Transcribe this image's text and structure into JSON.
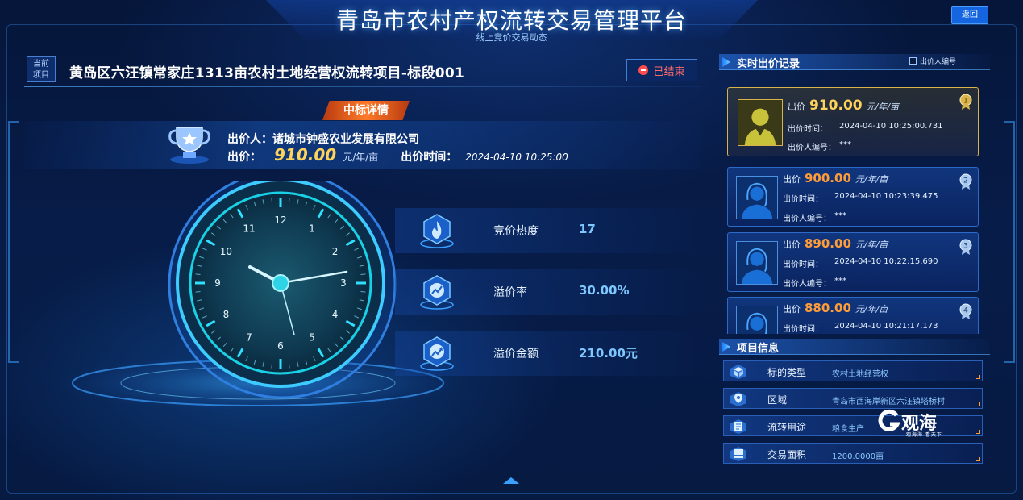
{
  "header": {
    "title": "青岛市农村产权流转交易管理平台",
    "subtitle": "线上竞价交易动态",
    "back_label": "返回"
  },
  "project": {
    "tag_line1": "当前",
    "tag_line2": "项目",
    "title": "黄岛区六汪镇常家庄1313亩农村土地经营权流转项目-标段001",
    "status": "已结束"
  },
  "winner": {
    "section_title": "中标详情",
    "bidder_label": "出价人：",
    "bidder_name": "诸城市钟盛农业发展有限公司",
    "price_label": "出价：",
    "price": "910.00",
    "unit": "元/年/亩",
    "time_label": "出价时间：",
    "time": "2024-04-10 10:25:00"
  },
  "clock": {
    "numbers": [
      "12",
      "1",
      "2",
      "3",
      "4",
      "5",
      "6",
      "7",
      "8",
      "9",
      "10",
      "11"
    ]
  },
  "stats": [
    {
      "label": "竞价热度",
      "value": "17",
      "icon": "flame-icon"
    },
    {
      "label": "溢价率",
      "value": "30.00%",
      "icon": "trend-icon"
    },
    {
      "label": "溢价金额",
      "value": "210.00元",
      "icon": "money-trend-icon"
    }
  ],
  "bids_panel": {
    "title": "实时出价记录",
    "toggle_label": "出价人编号",
    "price_label": "出价",
    "time_label": "出价时间：",
    "id_label": "出价人编号：",
    "unit": "元/年/亩",
    "items": [
      {
        "rank": "1",
        "price": "910.00",
        "time": "2024-04-10 10:25:00.731",
        "bidder_id": "***"
      },
      {
        "rank": "2",
        "price": "900.00",
        "time": "2024-04-10 10:23:39.475",
        "bidder_id": "***"
      },
      {
        "rank": "3",
        "price": "890.00",
        "time": "2024-04-10 10:22:15.690",
        "bidder_id": "***"
      },
      {
        "rank": "4",
        "price": "880.00",
        "time": "2024-04-10 10:21:17.173",
        "bidder_id": "***"
      }
    ]
  },
  "info_panel": {
    "title": "项目信息",
    "rows": [
      {
        "label": "标的类型",
        "value": "农村土地经营权",
        "icon": "cube-icon"
      },
      {
        "label": "区域",
        "value": "青岛市西海岸新区六汪镇塔桥村",
        "icon": "location-icon"
      },
      {
        "label": "流转用途",
        "value": "粮食生产",
        "icon": "document-icon"
      },
      {
        "label": "交易面积",
        "value": "1200.0000亩",
        "icon": "layers-icon"
      }
    ]
  },
  "watermark": {
    "text": "观海",
    "small": "观海海 看天下"
  },
  "colors": {
    "background": "#06163a",
    "accent": "#1e7dff",
    "gold": "#ffd25a",
    "orange": "#ff9c3a",
    "status_red": "#ff4d4d"
  }
}
